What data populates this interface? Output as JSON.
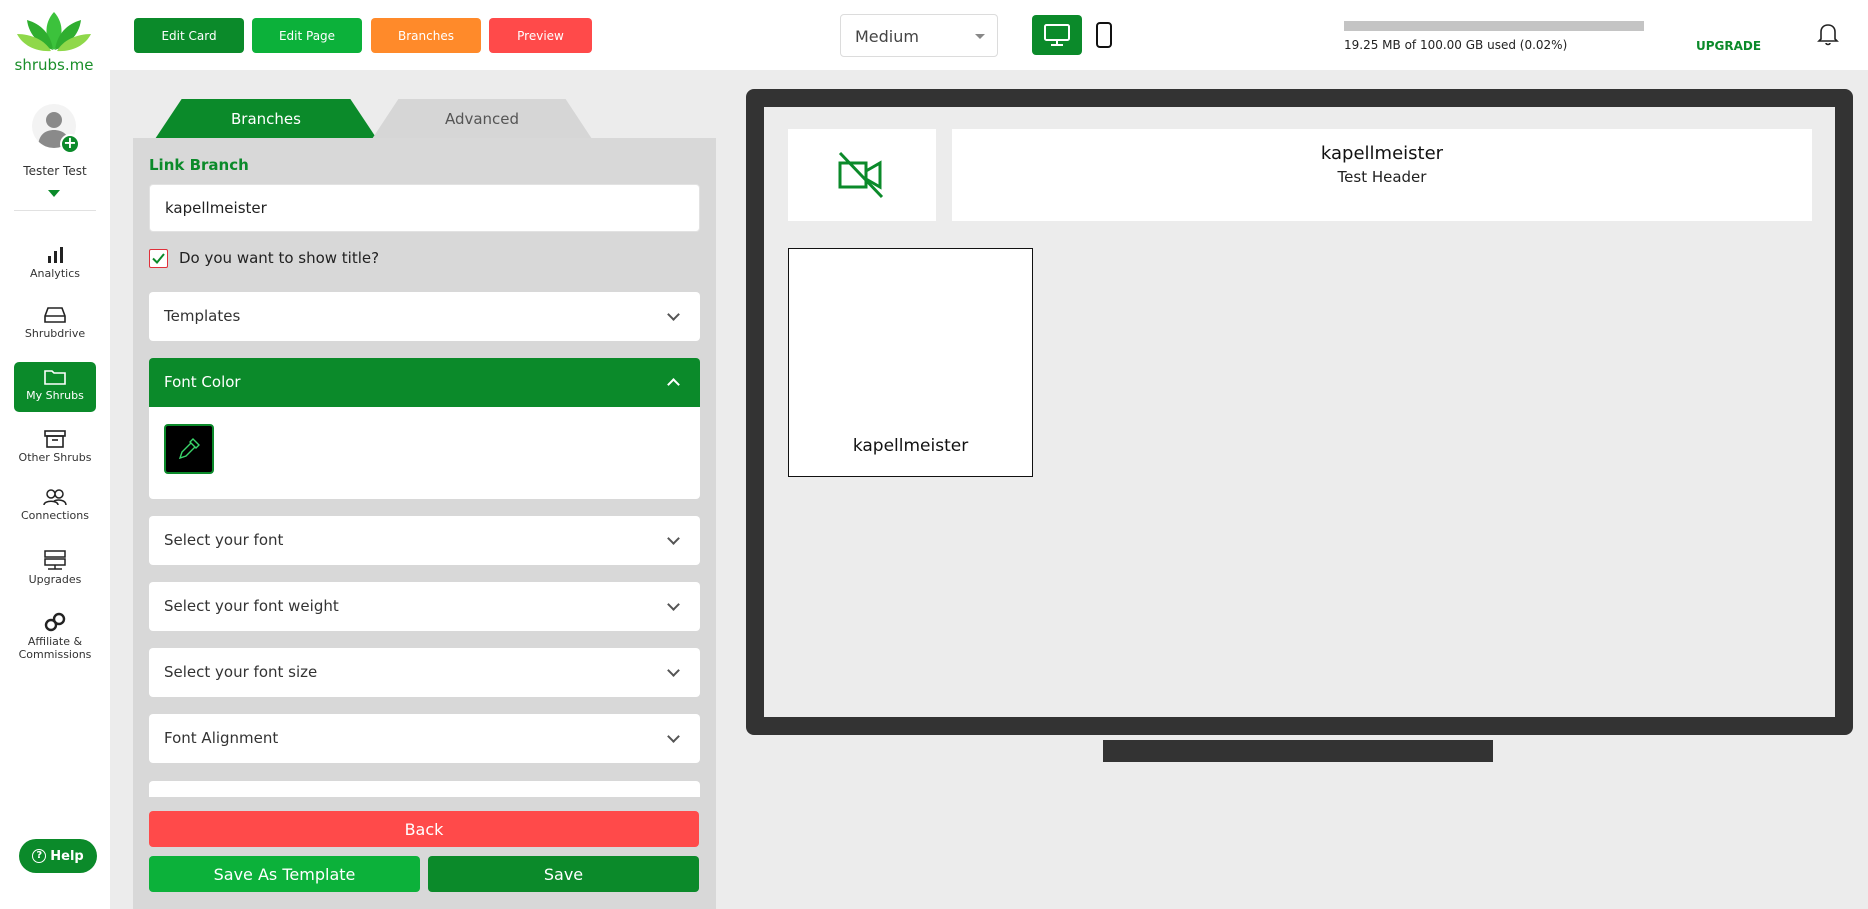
{
  "brand": {
    "logo_text": "shrubs.me",
    "primary": "#0b8a2a"
  },
  "user": {
    "name": "Tester Test"
  },
  "sidebar": {
    "items": [
      {
        "label": "Analytics",
        "icon": "bar-chart-icon"
      },
      {
        "label": "Shrubdrive",
        "icon": "drive-icon"
      },
      {
        "label": "My Shrubs",
        "icon": "folder-icon",
        "active": true
      },
      {
        "label": "Other Shrubs",
        "icon": "archive-icon"
      },
      {
        "label": "Connections",
        "icon": "users-icon"
      },
      {
        "label": "Upgrades",
        "icon": "server-icon"
      },
      {
        "label": "Affiliate & Commissions",
        "icon": "link-icon"
      }
    ],
    "help_label": "Help"
  },
  "toolbar": {
    "edit_card": "Edit Card",
    "edit_page": "Edit Page",
    "branches": "Branches",
    "preview": "Preview",
    "size_select": "Medium",
    "storage_text": "19.25 MB of 100.00 GB used (0.02%)",
    "storage_fraction": 0.0002,
    "upgrade": "UPGRADE"
  },
  "editor": {
    "tabs": [
      "Branches",
      "Advanced"
    ],
    "link_branch_label": "Link Branch",
    "link_branch_value": "kapellmeister",
    "show_title_label": "Do you want to show title?",
    "show_title_checked": true,
    "templates": "Templates",
    "font_color": "Font Color",
    "font_color_value": "#000000",
    "select_font": "Select your font",
    "select_font_weight": "Select your font weight",
    "select_font_size": "Select your font size",
    "font_alignment": "Font Alignment",
    "back": "Back",
    "save_as_template": "Save As Template",
    "save": "Save"
  },
  "preview": {
    "header_title": "kapellmeister",
    "header_subtitle": "Test Header",
    "branch_title": "kapellmeister"
  }
}
